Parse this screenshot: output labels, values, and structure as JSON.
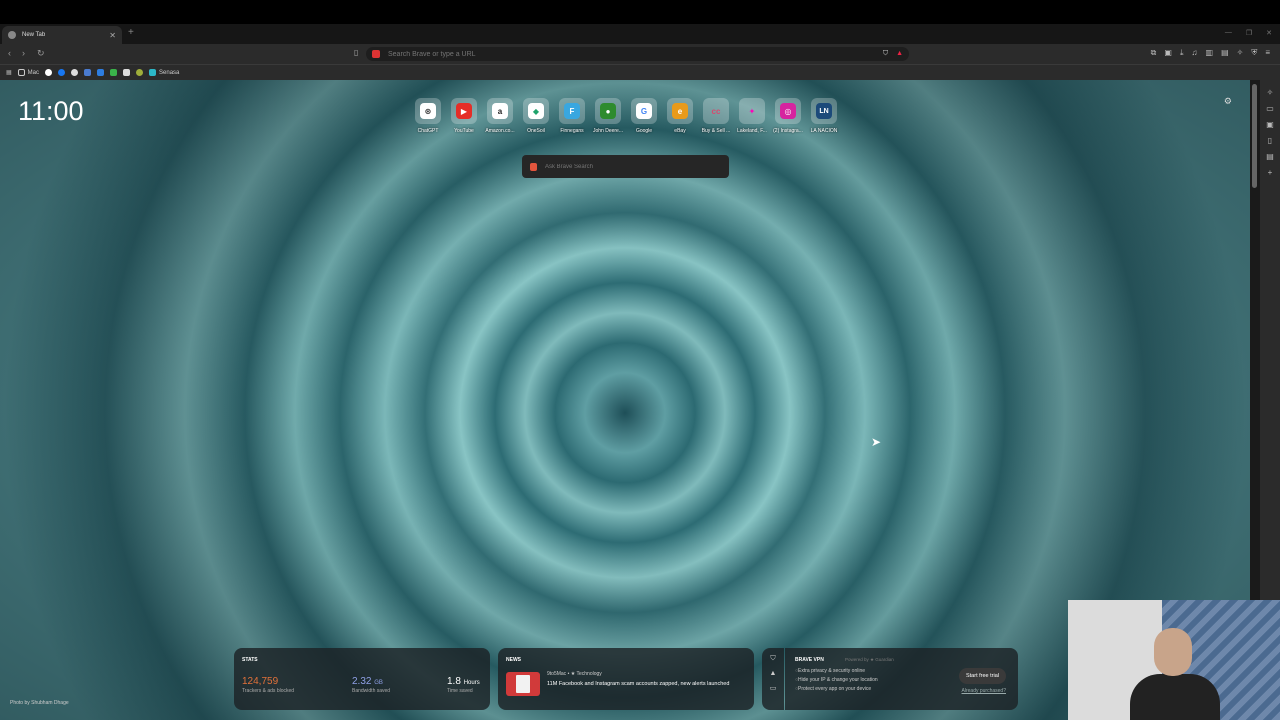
{
  "tabs": [
    {
      "title": "New Tab"
    }
  ],
  "omnibox": {
    "placeholder": "Search Brave or type a URL"
  },
  "bookmarks": [
    {
      "label": "Mac",
      "color": "#c9b27a"
    },
    {
      "label": "",
      "color": "#ffffff"
    },
    {
      "label": "",
      "color": "#1877f2"
    },
    {
      "label": "",
      "color": "#e0e0e0"
    },
    {
      "label": "",
      "color": "#4a7bd0"
    },
    {
      "label": "",
      "color": "#2d7de1"
    },
    {
      "label": "",
      "color": "#3ab34a"
    },
    {
      "label": "",
      "color": "#dddddd"
    },
    {
      "label": "",
      "color": "#9fae3a"
    },
    {
      "label": "Senasa",
      "color": "#2cb7c7"
    }
  ],
  "clock": "11:00",
  "top_sites": [
    {
      "label": "ChatGPT",
      "glyph": "⊛",
      "color": "#ffffff"
    },
    {
      "label": "YouTube",
      "glyph": "▶",
      "color": "#e52d27"
    },
    {
      "label": "Amazon.co...",
      "glyph": "a",
      "color": "#222222"
    },
    {
      "label": "OneSoil",
      "glyph": "◆",
      "color": "#1fa36b"
    },
    {
      "label": "Finnegans",
      "glyph": "F",
      "color": "#39a7e0"
    },
    {
      "label": "John Deere...",
      "glyph": "●",
      "color": "#2e8b2e"
    },
    {
      "label": "Google",
      "glyph": "G",
      "color": "#ffffff"
    },
    {
      "label": "eBay",
      "glyph": "e",
      "color": "#e89a1a"
    },
    {
      "label": "Buy & Sell ...",
      "glyph": "cc",
      "color": "#d64a6e"
    },
    {
      "label": "Lakeland, F...",
      "glyph": "✦",
      "color": "#6ab8e0"
    },
    {
      "label": "(2) Instagra...",
      "glyph": "◎",
      "color": "#d6249f"
    },
    {
      "label": "LA NACION",
      "glyph": "LN",
      "color": "#1c4a7a"
    }
  ],
  "search": {
    "placeholder": "Ask Brave Search"
  },
  "photo_credit": "Photo by Shubham Dhage",
  "stats": {
    "heading": "STATS",
    "trackers": {
      "value": "124,759",
      "label": "Trackers & ads blocked",
      "color": "#e2713a"
    },
    "bandwidth": {
      "value": "2.32",
      "unit": "GB",
      "label": "Bandwidth saved",
      "color": "#8fa0e6"
    },
    "time": {
      "value": "1.8",
      "unit": "Hours",
      "label": "Time saved",
      "color": "#ffffff"
    }
  },
  "news": {
    "heading": "NEWS",
    "source": "9to5Mac • ★ Technology",
    "title": "11M Facebook and Instagram scam accounts zapped, new alerts launched"
  },
  "vpn": {
    "heading": "BRAVE VPN",
    "powered": "Powered by ★ Guardian",
    "features": [
      "Extra privacy & security online",
      "Hide your IP & change your location",
      "Protect every app on your device"
    ],
    "cta": "Start free trial",
    "already": "Already purchased?"
  }
}
